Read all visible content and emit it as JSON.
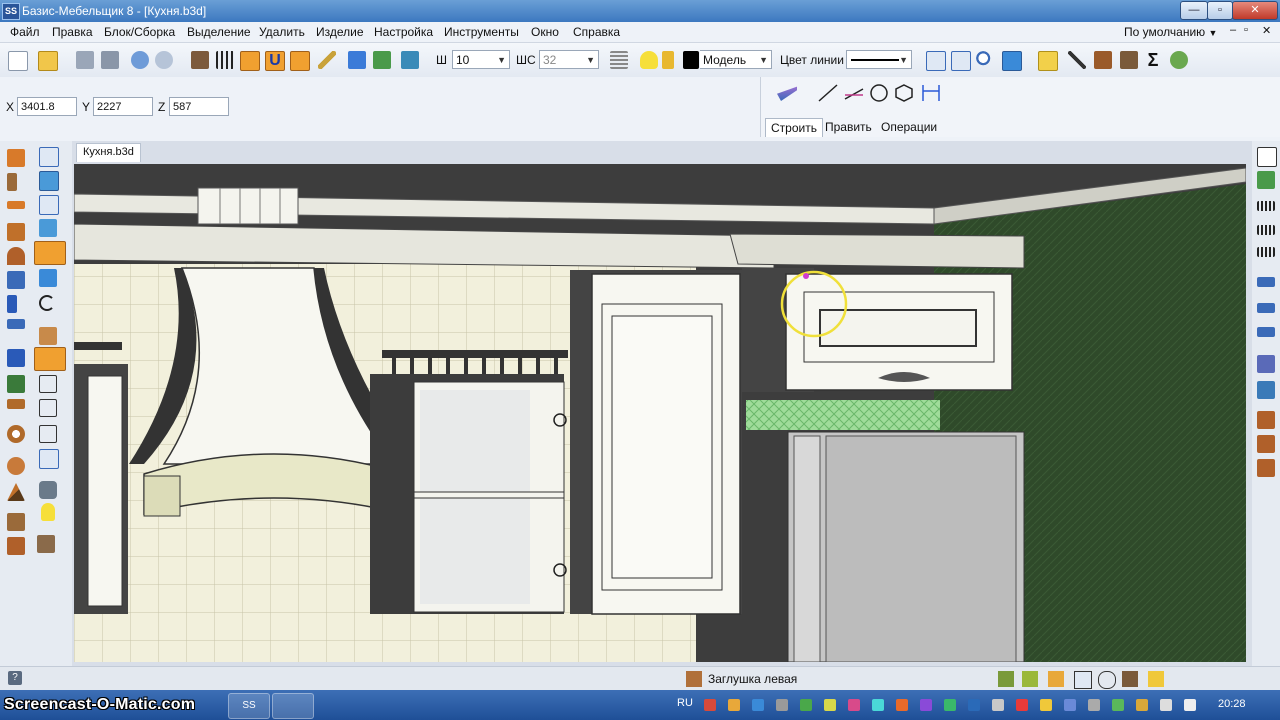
{
  "window": {
    "title": "Базис-Мебельщик 8 - [Кухня.b3d]",
    "app_icon": "SS",
    "minimize": "—",
    "restore": "▫",
    "close": "✕"
  },
  "menu": {
    "items": [
      "Файл",
      "Правка",
      "Блок/Сборка",
      "Выделение",
      "Удалить",
      "Изделие",
      "Настройка",
      "Инструменты",
      "Окно",
      "Справка"
    ],
    "preset": "По умолчанию",
    "mdi_minimize": "–",
    "mdi_restore": "▫",
    "mdi_close": "✕"
  },
  "toolbar": {
    "sh_label": "Ш",
    "sh_value": "10",
    "shc_label": "ШС",
    "shc_value": "32",
    "layer_value": "Модель",
    "line_color_label": "Цвет линии"
  },
  "coords": {
    "x_label": "X",
    "x_value": "3401.8",
    "y_label": "Y",
    "y_value": "2227",
    "z_label": "Z",
    "z_value": "587"
  },
  "build_panel": {
    "tabs": [
      "Строить",
      "Править",
      "Операции"
    ],
    "active_tab": "Строить"
  },
  "document": {
    "tab_label": "Кухня.b3d"
  },
  "statusbar": {
    "help_icon": "?",
    "object_name": "Заглушка левая"
  },
  "taskbar": {
    "watermark": "Screencast-O-Matic.com",
    "task_icon": "SS",
    "language": "RU",
    "clock": "20:28"
  }
}
